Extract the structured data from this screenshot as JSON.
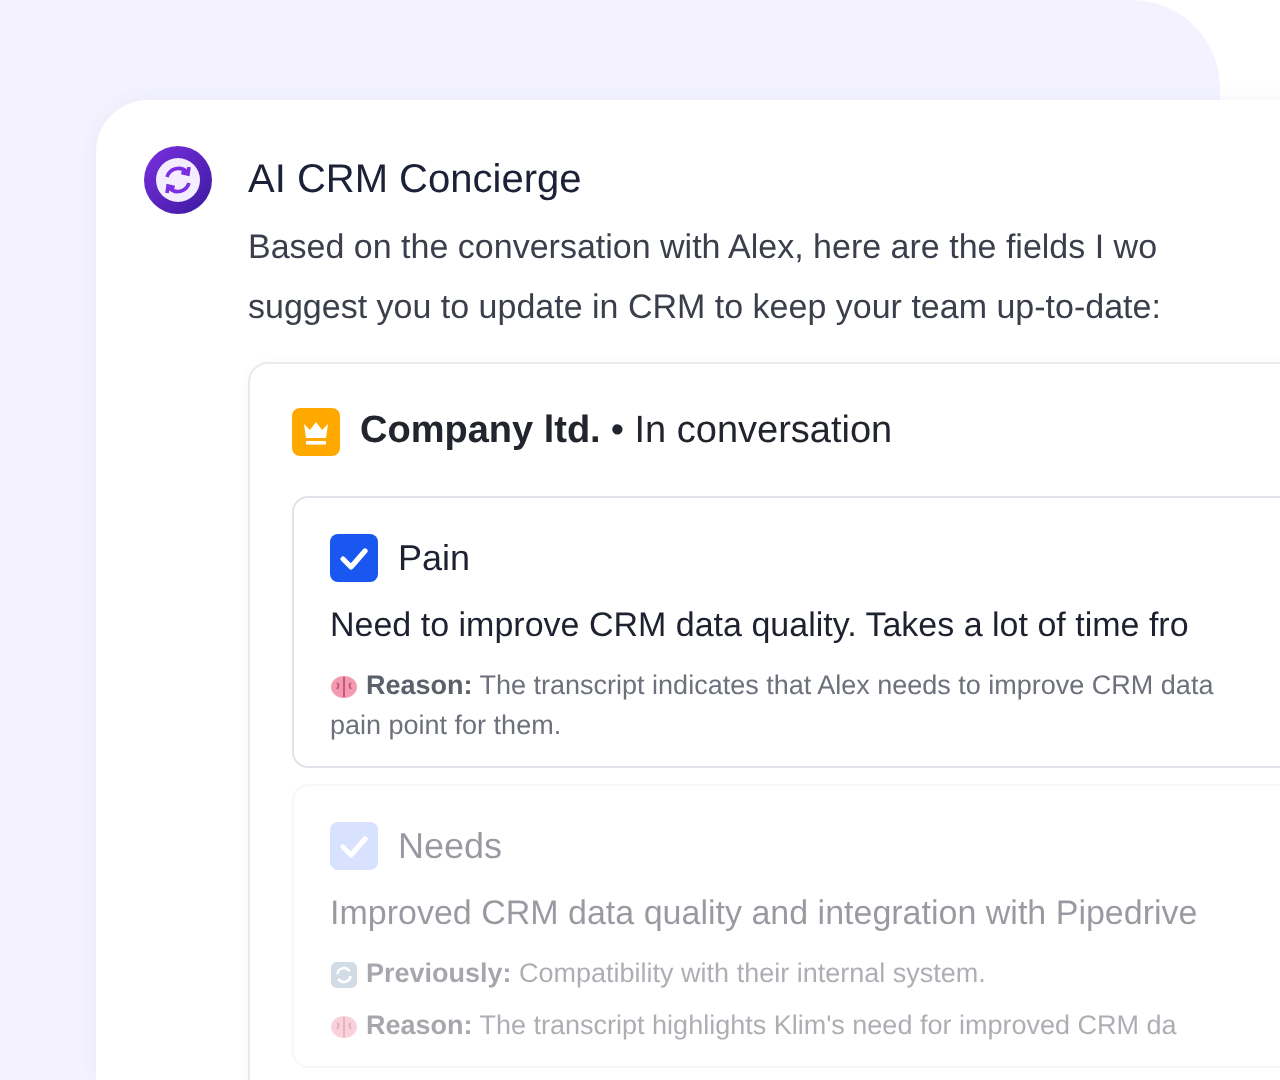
{
  "assistant": {
    "name": "AI CRM Concierge",
    "message_lines": [
      "Based on the conversation with Alex, here are the fields I wo",
      "suggest you to update in CRM to keep your team up-to-date:"
    ]
  },
  "company": {
    "name": "Company ltd.",
    "status": "• In conversation"
  },
  "fields": [
    {
      "label": "Pain",
      "checked": true,
      "disabled": false,
      "value": "Need to improve CRM data quality. Takes a lot of time fro",
      "notes": [
        {
          "kind": "reason",
          "label": "Reason:",
          "lines": [
            "The transcript indicates that Alex needs to improve CRM data",
            "pain point for them."
          ]
        }
      ]
    },
    {
      "label": "Needs",
      "checked": true,
      "disabled": true,
      "value": "Improved CRM data quality and integration with Pipedrive",
      "notes": [
        {
          "kind": "previously",
          "label": "Previously:",
          "lines": [
            "Compatibility with their internal system."
          ]
        },
        {
          "kind": "reason",
          "label": "Reason:",
          "lines": [
            "The transcript highlights Klim's need for improved CRM da"
          ]
        }
      ]
    }
  ]
}
